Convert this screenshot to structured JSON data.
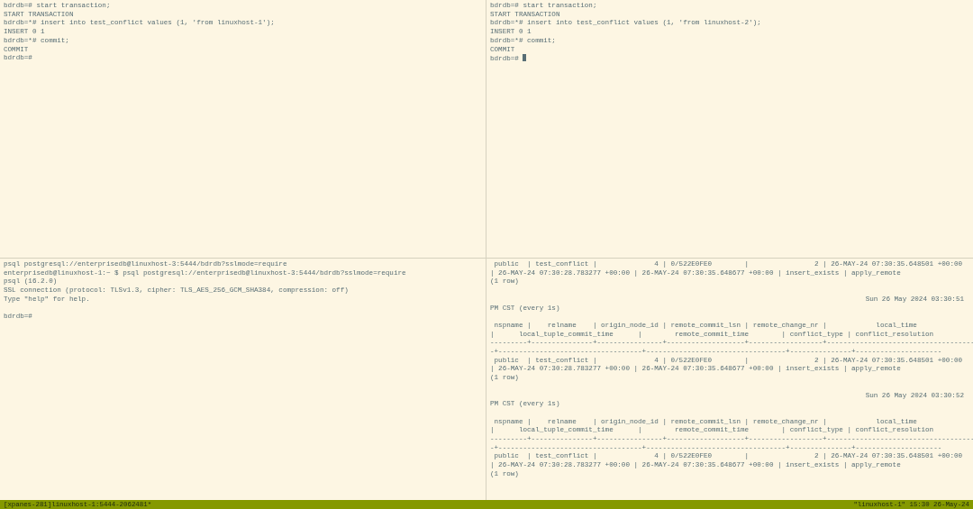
{
  "panes": [
    {
      "cursor": false,
      "blocks": [
        {
          "kind": "output",
          "lines": [
            "bdrdb=# start transaction;",
            "START TRANSACTION",
            "bdrdb=*# insert into test_conflict values (1, 'from linuxhost-1');",
            "INSERT 0 1",
            "bdrdb=*# commit;",
            "COMMIT",
            "bdrdb=#"
          ]
        }
      ]
    },
    {
      "cursor": true,
      "blocks": [
        {
          "kind": "output",
          "lines": [
            "bdrdb=# start transaction;",
            "START TRANSACTION",
            "bdrdb=*# insert into test_conflict values (1, 'from linuxhost-2');",
            "INSERT 0 1",
            "bdrdb=*# commit;",
            "COMMIT",
            "bdrdb=#"
          ]
        }
      ]
    },
    {
      "cursor": false,
      "blocks": [
        {
          "kind": "output",
          "lines": [
            "psql postgresql://enterprisedb@linuxhost-3:5444/bdrdb?sslmode=require",
            "enterprisedb@linuxhost-1:~ $ psql postgresql://enterprisedb@linuxhost-3:5444/bdrdb?sslmode=require",
            "psql (16.2.0)",
            "SSL connection (protocol: TLSv1.3, cipher: TLS_AES_256_GCM_SHA384, compression: off)",
            "Type \"help\" for help."
          ]
        },
        {
          "kind": "output",
          "lines": [
            "bdrdb=#"
          ]
        }
      ]
    },
    {
      "cursor": false,
      "blocks": [
        {
          "kind": "output",
          "lines": [
            " public  | test_conflict |              4 | 0/522E0FE0        |                2 | 26-MAY-24 07:30:35.648501 +00:00",
            "| 26-MAY-24 07:30:28.783277 +00:00 | 26-MAY-24 07:30:35.648677 +00:00 | insert_exists | apply_remote",
            "(1 row)"
          ]
        },
        {
          "kind": "watch_header",
          "time": "Sun 26 May 2024 03:30:51",
          "caption": "PM CST (every 1s)"
        },
        {
          "kind": "output",
          "lines": [
            " nspname |    relname    | origin_node_id | remote_commit_lsn | remote_change_nr |            local_time",
            "|      local_tuple_commit_time      |        remote_commit_time        | conflict_type | conflict_resolution",
            "---------+---------------+----------------+-------------------+------------------+------------------------------------",
            "-+-----------------------------------+----------------------------------+---------------+---------------------",
            " public  | test_conflict |              4 | 0/522E0FE0        |                2 | 26-MAY-24 07:30:35.648501 +00:00",
            "| 26-MAY-24 07:30:28.783277 +00:00 | 26-MAY-24 07:30:35.648677 +00:00 | insert_exists | apply_remote",
            "(1 row)"
          ]
        },
        {
          "kind": "watch_header",
          "time": "Sun 26 May 2024 03:30:52",
          "caption": "PM CST (every 1s)"
        },
        {
          "kind": "output",
          "lines": [
            " nspname |    relname    | origin_node_id | remote_commit_lsn | remote_change_nr |            local_time",
            "|      local_tuple_commit_time      |        remote_commit_time        | conflict_type | conflict_resolution",
            "---------+---------------+----------------+-------------------+------------------+------------------------------------",
            "-+-----------------------------------+----------------------------------+---------------+---------------------",
            " public  | test_conflict |              4 | 0/522E0FE0        |                2 | 26-MAY-24 07:30:35.648501 +00:00",
            "| 26-MAY-24 07:30:28.783277 +00:00 | 26-MAY-24 07:30:35.648677 +00:00 | insert_exists | apply_remote",
            "(1 row)"
          ]
        }
      ]
    }
  ],
  "status_bar": {
    "left": "[xpanes-281]linuxhost-1:5444-2062481*",
    "right": "\"linuxhost-1\" 15:30 26-May-24"
  }
}
